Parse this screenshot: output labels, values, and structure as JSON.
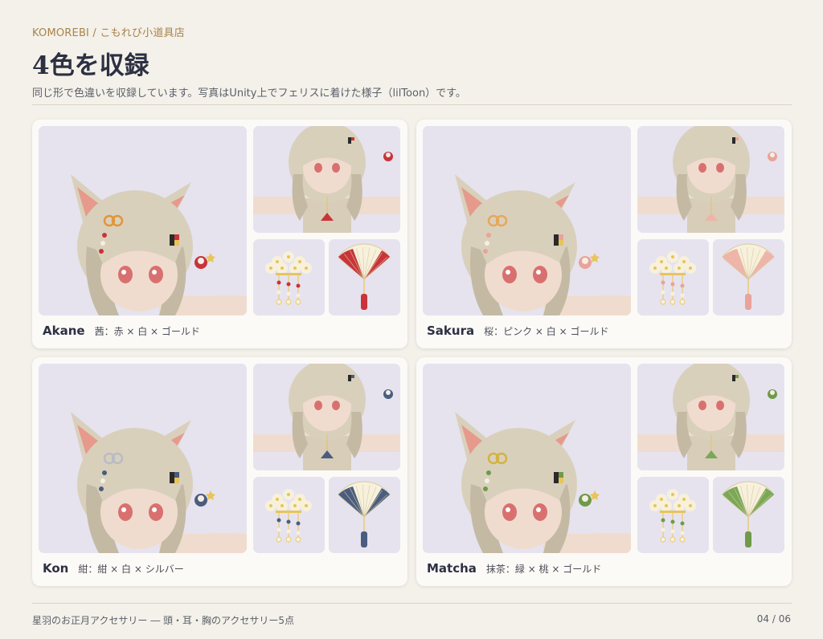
{
  "header": {
    "brand": "KOMOREBI / こもれび小道具店",
    "title": "4色を収録",
    "subtitle": "同じ形で色違いを収録しています。写真はUnity上でフェリスに着けた様子（lilToon）です。"
  },
  "variants": [
    {
      "name": "Akane",
      "desc": "茜：赤 × 白 × ゴールド",
      "accent": "#c8343a",
      "bead": "#c8343a",
      "fan": "#c8343a",
      "bow": "#e0963a"
    },
    {
      "name": "Sakura",
      "desc": "桜：ピンク × 白 × ゴールド",
      "accent": "#e9a39a",
      "bead": "#e9a39a",
      "fan": "#f0b3a9",
      "bow": "#e6a85a"
    },
    {
      "name": "Kon",
      "desc": "紺：紺 × 白 × シルバー",
      "accent": "#4a5d80",
      "bead": "#4a5d80",
      "fan": "#4a5d80",
      "bow": "#b8bcc4"
    },
    {
      "name": "Matcha",
      "desc": "抹茶：緑 × 桃 × ゴールド",
      "accent": "#6f9a4a",
      "bead": "#6f9a4a",
      "fan": "#79a857",
      "bow": "#d4b23e"
    }
  ],
  "footer": {
    "left": "星羽のお正月アクセサリー ― 頭・耳・胸のアクセサリー5点",
    "page": "04 / 06"
  }
}
